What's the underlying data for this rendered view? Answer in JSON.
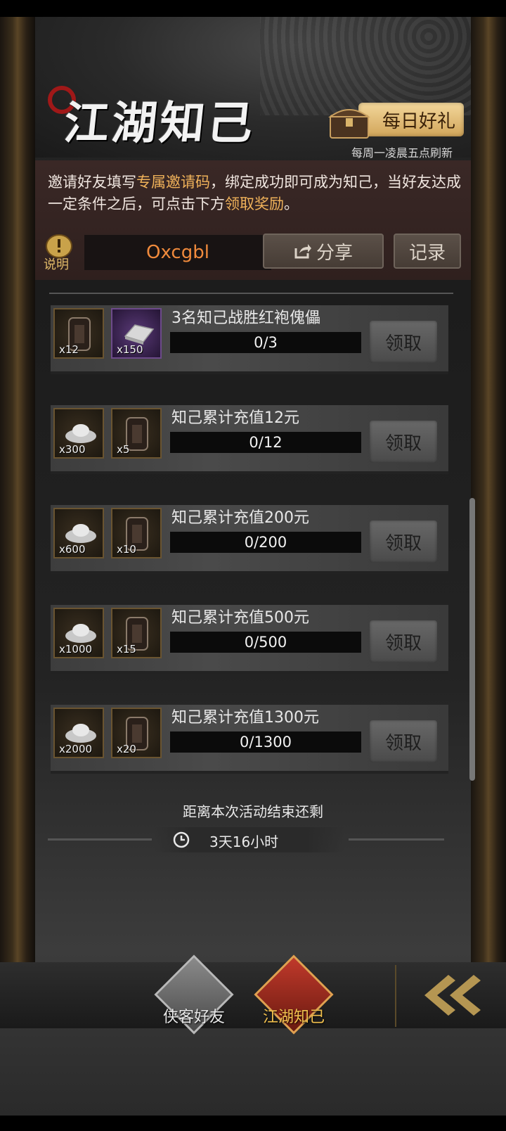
{
  "header": {
    "title": "江湖知己",
    "daily_gift_label": "每日好礼",
    "refresh_note": "每周一凌晨五点刷新"
  },
  "invite": {
    "text_parts": [
      "邀请好友填写",
      "专属邀请码",
      "，绑定成功即可成为知己，当好友达成一定条件之后，可点击下方",
      "领取奖励",
      "。"
    ],
    "info_label": "说明",
    "code": "Oxcgbl",
    "share_label": "分享",
    "record_label": "记录"
  },
  "tasks": [
    {
      "title": "3名知己战胜红袍傀儡",
      "progress": "0/3",
      "claim_label": "领取",
      "rewards": [
        {
          "type": "token",
          "count": "x12"
        },
        {
          "type": "silver-bar",
          "count": "x150"
        }
      ]
    },
    {
      "title": "知己累计充值12元",
      "progress": "0/12",
      "claim_label": "领取",
      "rewards": [
        {
          "type": "ingot",
          "count": "x300"
        },
        {
          "type": "token",
          "count": "x5"
        }
      ]
    },
    {
      "title": "知己累计充值200元",
      "progress": "0/200",
      "claim_label": "领取",
      "rewards": [
        {
          "type": "ingot",
          "count": "x600"
        },
        {
          "type": "token",
          "count": "x10"
        }
      ]
    },
    {
      "title": "知己累计充值500元",
      "progress": "0/500",
      "claim_label": "领取",
      "rewards": [
        {
          "type": "ingot",
          "count": "x1000"
        },
        {
          "type": "token",
          "count": "x15"
        }
      ]
    },
    {
      "title": "知己累计充值1300元",
      "progress": "0/1300",
      "claim_label": "领取",
      "rewards": [
        {
          "type": "ingot",
          "count": "x2000"
        },
        {
          "type": "token",
          "count": "x20"
        }
      ]
    }
  ],
  "countdown": {
    "label": "距离本次活动结束还剩",
    "value": "3天16小时"
  },
  "nav": {
    "items": [
      {
        "label": "侠客好友",
        "active": false
      },
      {
        "label": "江湖知己",
        "active": true
      }
    ]
  },
  "colors": {
    "highlight": "#f0b25a",
    "code": "#f08a3c",
    "active_nav": "#f2c14e",
    "inactive_nav": "#e8e8e8"
  }
}
